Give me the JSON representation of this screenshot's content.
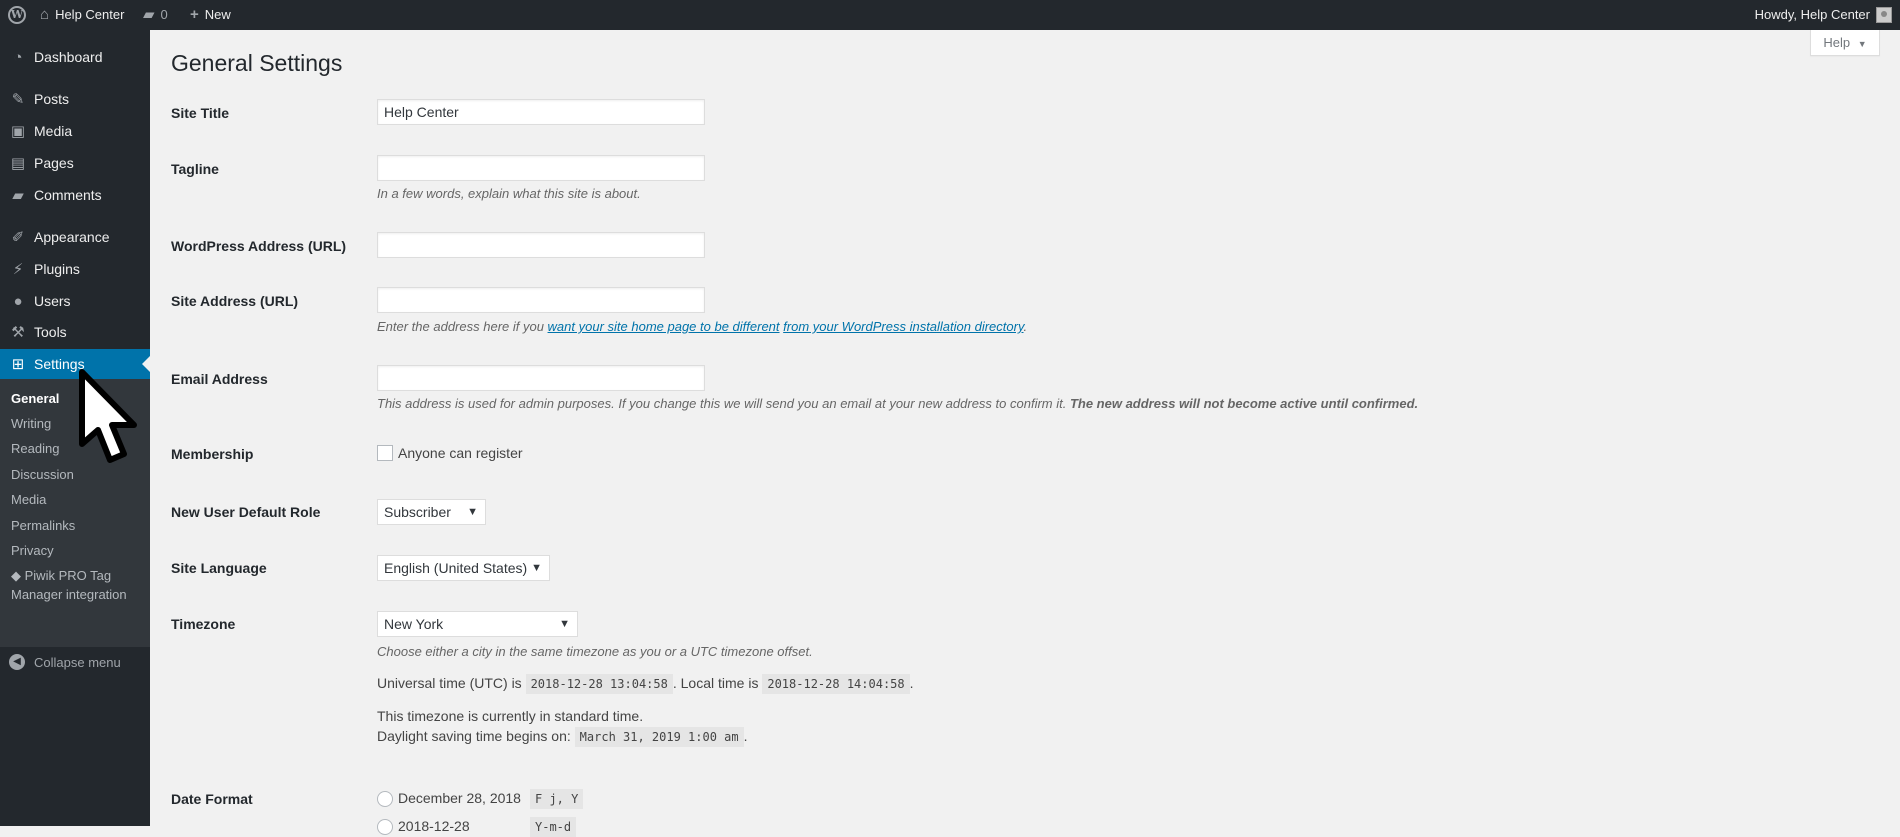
{
  "admin_bar": {
    "site_name": "Help Center",
    "comments_count": "0",
    "new_label": "New",
    "howdy": "Howdy, Help Center"
  },
  "sidebar": {
    "items": [
      {
        "label": "Dashboard",
        "icon": "dashboard-icon"
      },
      {
        "label": "Posts",
        "icon": "pin-icon"
      },
      {
        "label": "Media",
        "icon": "media-icon"
      },
      {
        "label": "Pages",
        "icon": "pages-icon"
      },
      {
        "label": "Comments",
        "icon": "comment-icon"
      },
      {
        "label": "Appearance",
        "icon": "brush-icon"
      },
      {
        "label": "Plugins",
        "icon": "plug-icon"
      },
      {
        "label": "Users",
        "icon": "user-icon"
      },
      {
        "label": "Tools",
        "icon": "wrench-icon"
      },
      {
        "label": "Settings",
        "icon": "settings-icon"
      }
    ],
    "submenu": [
      "General",
      "Writing",
      "Reading",
      "Discussion",
      "Media",
      "Permalinks",
      "Privacy"
    ],
    "piwik_line1": "Piwik PRO Tag",
    "piwik_line2": "Manager integration",
    "collapse": "Collapse menu"
  },
  "help_tab": "Help",
  "page_title": "General Settings",
  "form": {
    "site_title_label": "Site Title",
    "site_title_value": "Help Center",
    "tagline_label": "Tagline",
    "tagline_value": "",
    "tagline_desc": "In a few words, explain what this site is about.",
    "wp_address_label": "WordPress Address (URL)",
    "wp_address_value": "",
    "site_address_label": "Site Address (URL)",
    "site_address_value": "",
    "site_address_desc_pre": "Enter the address here if you ",
    "site_address_link1": "want your site home page to be different",
    "site_address_link2": "from your WordPress installation directory",
    "site_address_desc_post": ".",
    "email_label": "Email Address",
    "email_value": "",
    "email_desc": "This address is used for admin purposes. If you change this we will send you an email at your new address to confirm it. ",
    "email_desc_bold": "The new address will not become active until confirmed.",
    "membership_label": "Membership",
    "membership_checkbox": "Anyone can register",
    "role_label": "New User Default Role",
    "role_value": "Subscriber",
    "language_label": "Site Language",
    "language_value": "English (United States)",
    "timezone_label": "Timezone",
    "timezone_value": "New York",
    "timezone_desc": "Choose either a city in the same timezone as you or a UTC timezone offset.",
    "utc_pre": "Universal time (UTC) is ",
    "utc_value": "2018-12-28 13:04:58",
    "local_pre": ". Local time is ",
    "local_value": "2018-12-28 14:04:58",
    "local_post": ".",
    "standard_time": "This timezone is currently in standard time.",
    "dst_pre": "Daylight saving time begins on: ",
    "dst_value": "March 31, 2019 1:00 am",
    "dst_post": ".",
    "date_format_label": "Date Format",
    "date_option1": "December 28, 2018",
    "date_option1_code": "F j, Y",
    "date_option2": "2018-12-28",
    "date_option2_code": "Y-m-d"
  }
}
